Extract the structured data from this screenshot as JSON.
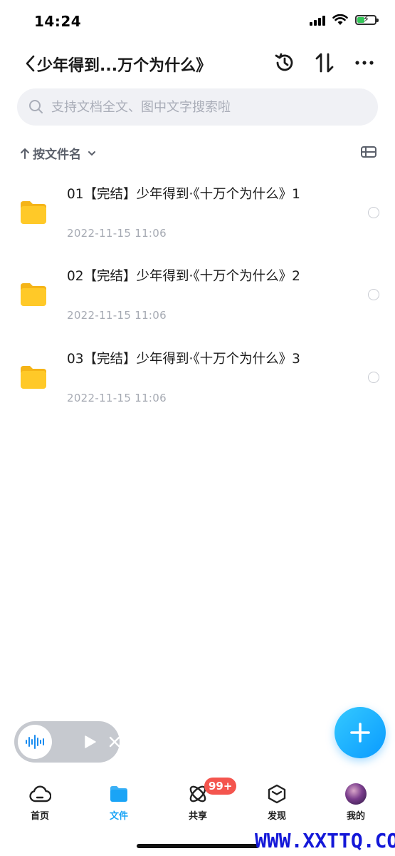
{
  "status_bar": {
    "time": "14:24"
  },
  "header": {
    "title": "少年得到...万个为什么》"
  },
  "search": {
    "placeholder": "支持文档全文、图中文字搜索啦"
  },
  "sort": {
    "label": "按文件名"
  },
  "files": [
    {
      "name": "01【完结】少年得到·《十万个为什么》1",
      "date": "2022-11-15 11:06"
    },
    {
      "name": "02【完结】少年得到·《十万个为什么》2",
      "date": "2022-11-15 11:06"
    },
    {
      "name": "03【完结】少年得到·《十万个为什么》3",
      "date": "2022-11-15 11:06"
    }
  ],
  "tabbar": {
    "items": [
      {
        "label": "首页",
        "icon": "cloud-icon"
      },
      {
        "label": "文件",
        "icon": "folder-icon"
      },
      {
        "label": "共享",
        "icon": "orbit-icon"
      },
      {
        "label": "发现",
        "icon": "cube-icon"
      },
      {
        "label": "我的",
        "icon": "avatar"
      }
    ],
    "active_index": 1,
    "share_badge": "99+"
  },
  "colors": {
    "accent": "#1aa4f6",
    "folder": "#ffc928",
    "badge": "#f4554e"
  },
  "watermark": "WWW.XXTTQ.COM"
}
